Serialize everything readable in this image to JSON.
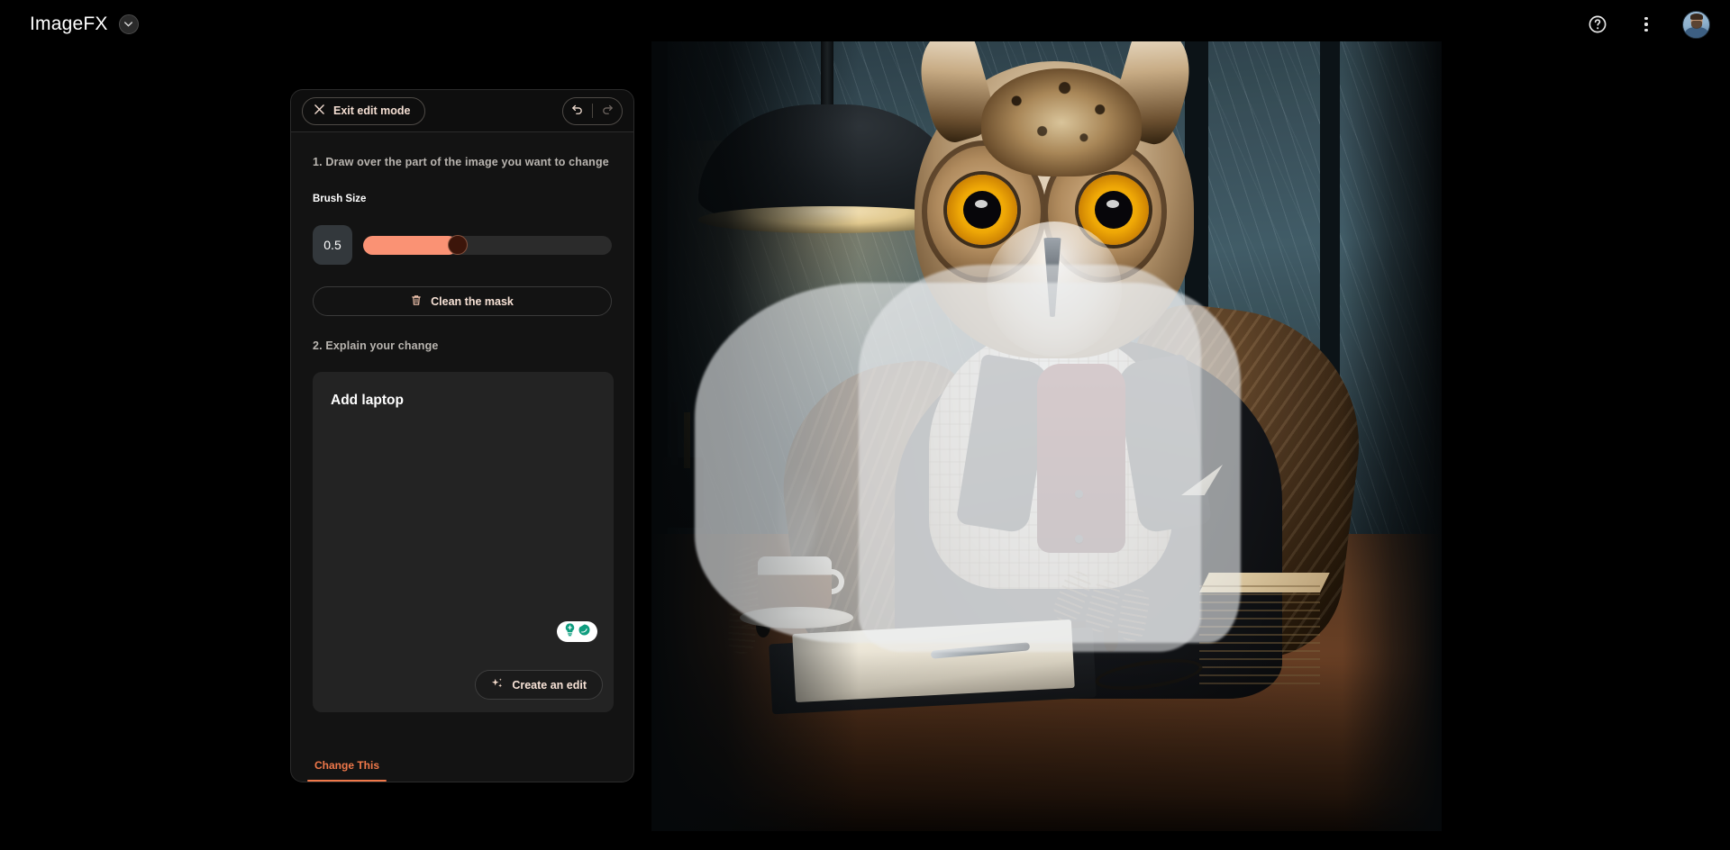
{
  "app": {
    "title": "ImageFX",
    "brand_chevron_icon": "chevron-down-icon"
  },
  "topbar": {
    "help_icon": "help-circle-icon",
    "more_icon": "more-vertical-icon",
    "avatar_name": "user-avatar"
  },
  "edit_panel": {
    "exit_label": "Exit edit mode",
    "exit_icon": "close-icon",
    "undo_icon": "undo-icon",
    "redo_icon": "redo-icon",
    "step1_label": "1. Draw over the part of the image you want to change",
    "brush_size_label": "Brush Size",
    "brush_size_value": "0.5",
    "brush_fill_percent": 38,
    "clean_mask_label": "Clean the mask",
    "clean_mask_icon": "trash-icon",
    "step2_label": "2. Explain your change",
    "prompt_value": "Add laptop",
    "prompt_placeholder": "Explain your change",
    "create_edit_label": "Create an edit",
    "create_edit_icon": "sparkles-icon",
    "badge_icons": [
      "lightbulb-icon",
      "chat-bubble-icon"
    ],
    "tab_label": "Change This"
  },
  "colors": {
    "accent": "#f0784a",
    "slider_fill": "#fa9274",
    "slider_thumb": "#3c150a",
    "panel_bg": "#131313",
    "prompt_bg": "#232323",
    "badge_teal": "#0f9d7f",
    "text_peach": "#f7e2d6"
  },
  "footer": {
    "note": ""
  },
  "image": {
    "alt": "Owl in a suit sitting at a desk with coffee, papers and books by a rainy window",
    "mask_visible": true
  }
}
